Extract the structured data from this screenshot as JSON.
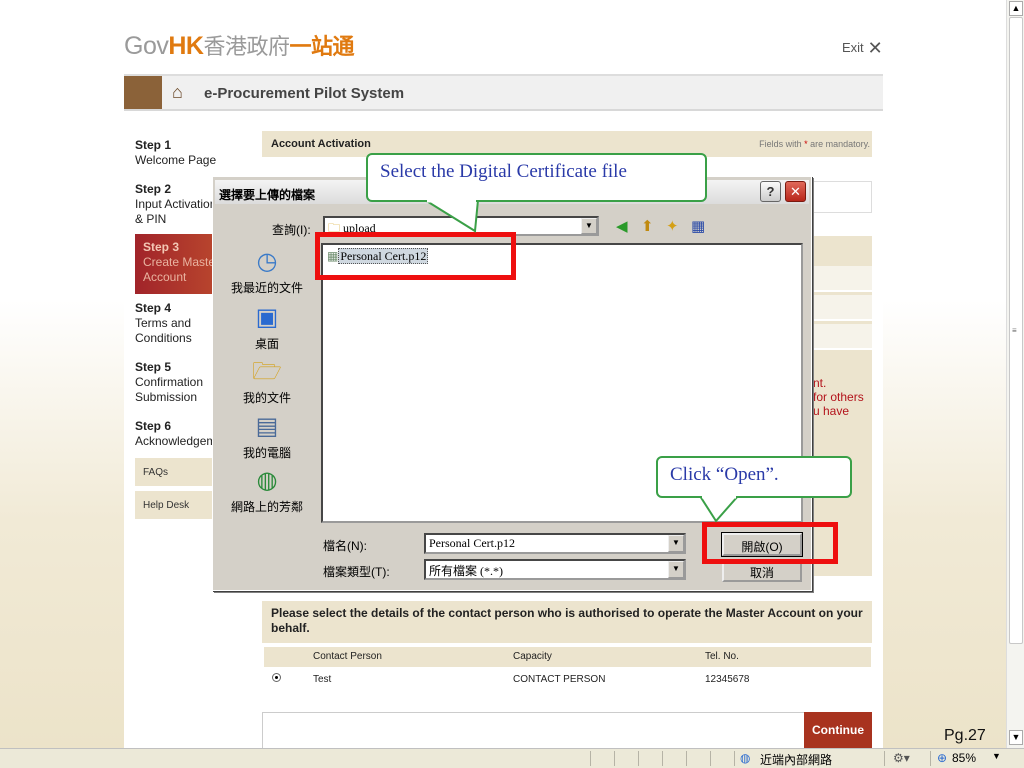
{
  "header": {
    "logo_gov": "Gov",
    "logo_hk": "HK",
    "logo_zh1": "香港政府",
    "logo_zh2": "一站通",
    "exit_label": "Exit"
  },
  "banner": {
    "title": "e-Procurement Pilot System"
  },
  "steps": [
    {
      "num": "Step 1",
      "label": "Welcome Page"
    },
    {
      "num": "Step 2",
      "label": "Input Activation",
      "label2": "& PIN"
    },
    {
      "num": "Step 3",
      "label": "Create Master",
      "label2": "Account"
    },
    {
      "num": "Step 4",
      "label": "Terms and",
      "label2": "Conditions"
    },
    {
      "num": "Step 5",
      "label": "Confirmation",
      "label2": "Submission"
    },
    {
      "num": "Step 6",
      "label": "Acknowledgement"
    }
  ],
  "side_links": {
    "faqs": "FAQs",
    "help": "Help Desk"
  },
  "account_bar": {
    "title": "Account Activation",
    "mandatory_prefix": "Fields with ",
    "mandatory_star": "*",
    "mandatory_suffix": " are mandatory."
  },
  "partial_red_text": [
    "nt.",
    "for others",
    "u have"
  ],
  "select_contact": "Please select the details of the contact person who is authorised to operate the Master Account on your behalf.",
  "contact_table": {
    "headers": [
      "Contact Person",
      "Capacity",
      "Tel. No."
    ],
    "rows": [
      {
        "person": "Test",
        "capacity": "CONTACT PERSON",
        "tel": "12345678"
      }
    ]
  },
  "continue_button": "Continue",
  "dialog": {
    "title": "選擇要上傳的檔案",
    "look_in_label": "查詢(I):",
    "look_in_value": "upload",
    "places": [
      "我最近的文件",
      "桌面",
      "我的文件",
      "我的電腦",
      "網路上的芳鄰"
    ],
    "files": [
      "Personal Cert.p12"
    ],
    "filename_label": "檔名(N):",
    "filename_value": "Personal Cert.p12",
    "filetype_label": "檔案類型(T):",
    "filetype_value": "所有檔案 (*.*)",
    "open_button": "開啟(O)",
    "cancel_button": "取消"
  },
  "callouts": {
    "select_file": "Select the Digital Certificate file",
    "click_open": "Click “Open”."
  },
  "page_number": "Pg.27",
  "status_bar": {
    "zone": "近端內部網路",
    "zoom": "85%"
  },
  "colors": {
    "accent_orange": "#e07a10",
    "callout_green": "#3aa047",
    "highlight_red": "#ee0f0f",
    "step_active": "#a1242a"
  }
}
